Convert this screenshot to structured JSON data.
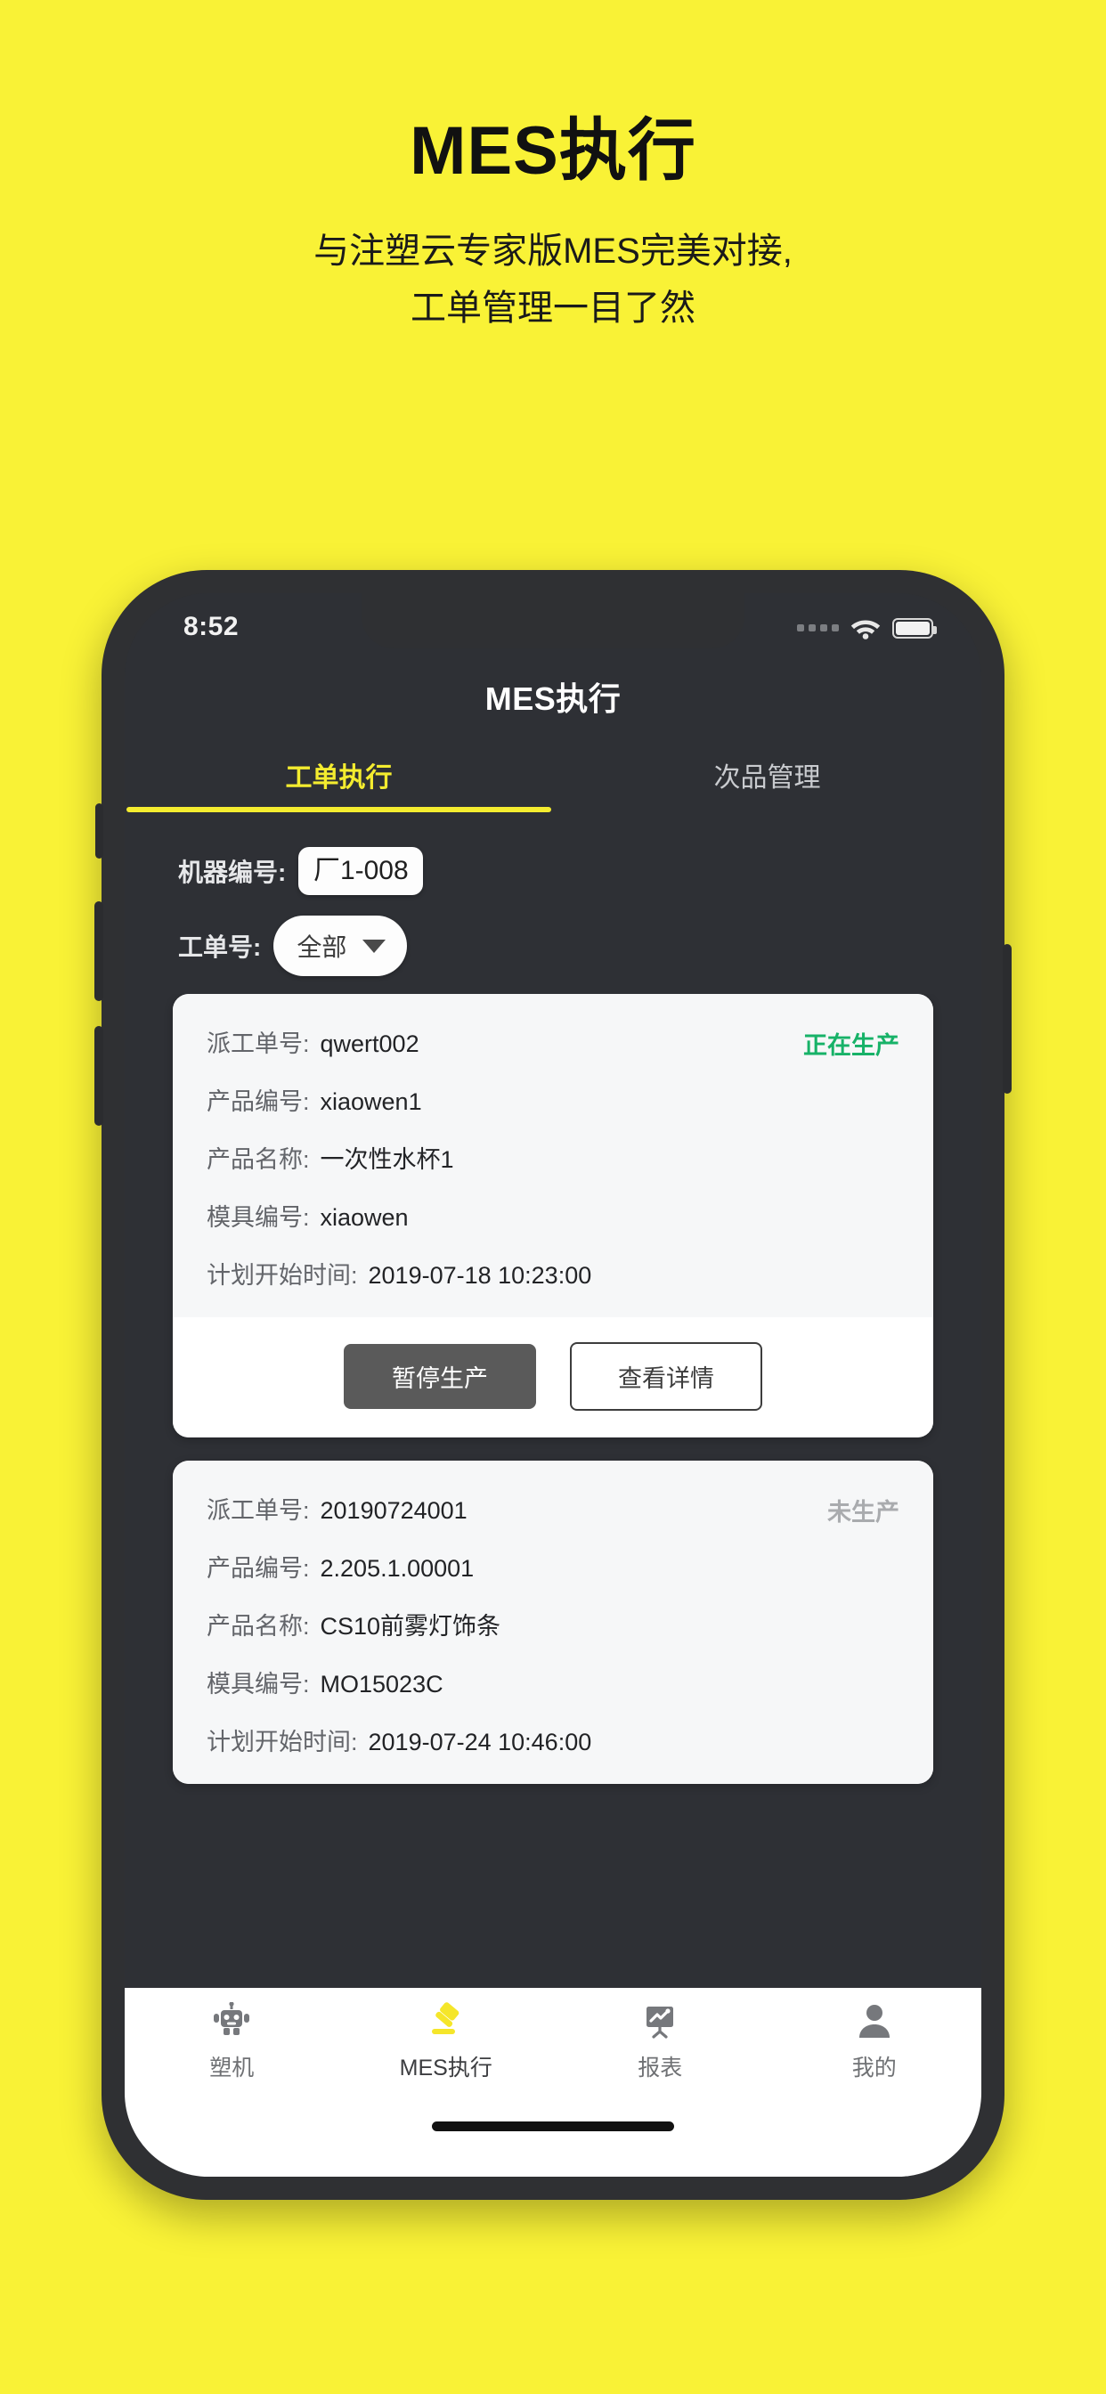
{
  "promo": {
    "title": "MES执行",
    "subtitle_line1": "与注塑云专家版MES完美对接,",
    "subtitle_line2": "工单管理一目了然",
    "background_color": "#f9f236",
    "text_color": "#111111"
  },
  "status_bar": {
    "time": "8:52",
    "signal_icon": "signal-dots-icon",
    "wifi_icon": "wifi-icon",
    "battery_icon": "battery-full-icon"
  },
  "app_bar": {
    "title": "MES执行"
  },
  "tabs": {
    "active_index": 0,
    "active_color": "#f4ec2f",
    "items": [
      {
        "label": "工单执行"
      },
      {
        "label": "次品管理"
      }
    ]
  },
  "filters": {
    "machine": {
      "label": "机器编号:",
      "value": "厂1-008"
    },
    "work_order": {
      "label": "工单号:",
      "value": "全部",
      "caret_icon": "chevron-down-icon"
    }
  },
  "cards": [
    {
      "status": "正在生产",
      "status_color": "#17b268",
      "rows": [
        {
          "key": "派工单号:",
          "value": "qwert002"
        },
        {
          "key": "产品编号:",
          "value": "xiaowen1"
        },
        {
          "key": "产品名称:",
          "value": "一次性水杯1"
        },
        {
          "key": "模具编号:",
          "value": "xiaowen"
        },
        {
          "key": "计划开始时间:",
          "value": "2019-07-18 10:23:00"
        }
      ],
      "actions": [
        {
          "label": "暂停生产",
          "style": "primary"
        },
        {
          "label": "查看详情",
          "style": "outline"
        }
      ]
    },
    {
      "status": "未生产",
      "status_color": "#a9abae",
      "rows": [
        {
          "key": "派工单号:",
          "value": "20190724001"
        },
        {
          "key": "产品编号:",
          "value": "2.205.1.00001"
        },
        {
          "key": "产品名称:",
          "value": "CS10前雾灯饰条"
        },
        {
          "key": "模具编号:",
          "value": "MO15023C"
        },
        {
          "key": "计划开始时间:",
          "value": "2019-07-24 10:46:00"
        }
      ],
      "actions": []
    }
  ],
  "bottom_nav": {
    "active_index": 1,
    "items": [
      {
        "label": "塑机",
        "icon": "robot-icon"
      },
      {
        "label": "MES执行",
        "icon": "gavel-icon"
      },
      {
        "label": "报表",
        "icon": "chart-board-icon"
      },
      {
        "label": "我的",
        "icon": "person-icon"
      }
    ]
  }
}
